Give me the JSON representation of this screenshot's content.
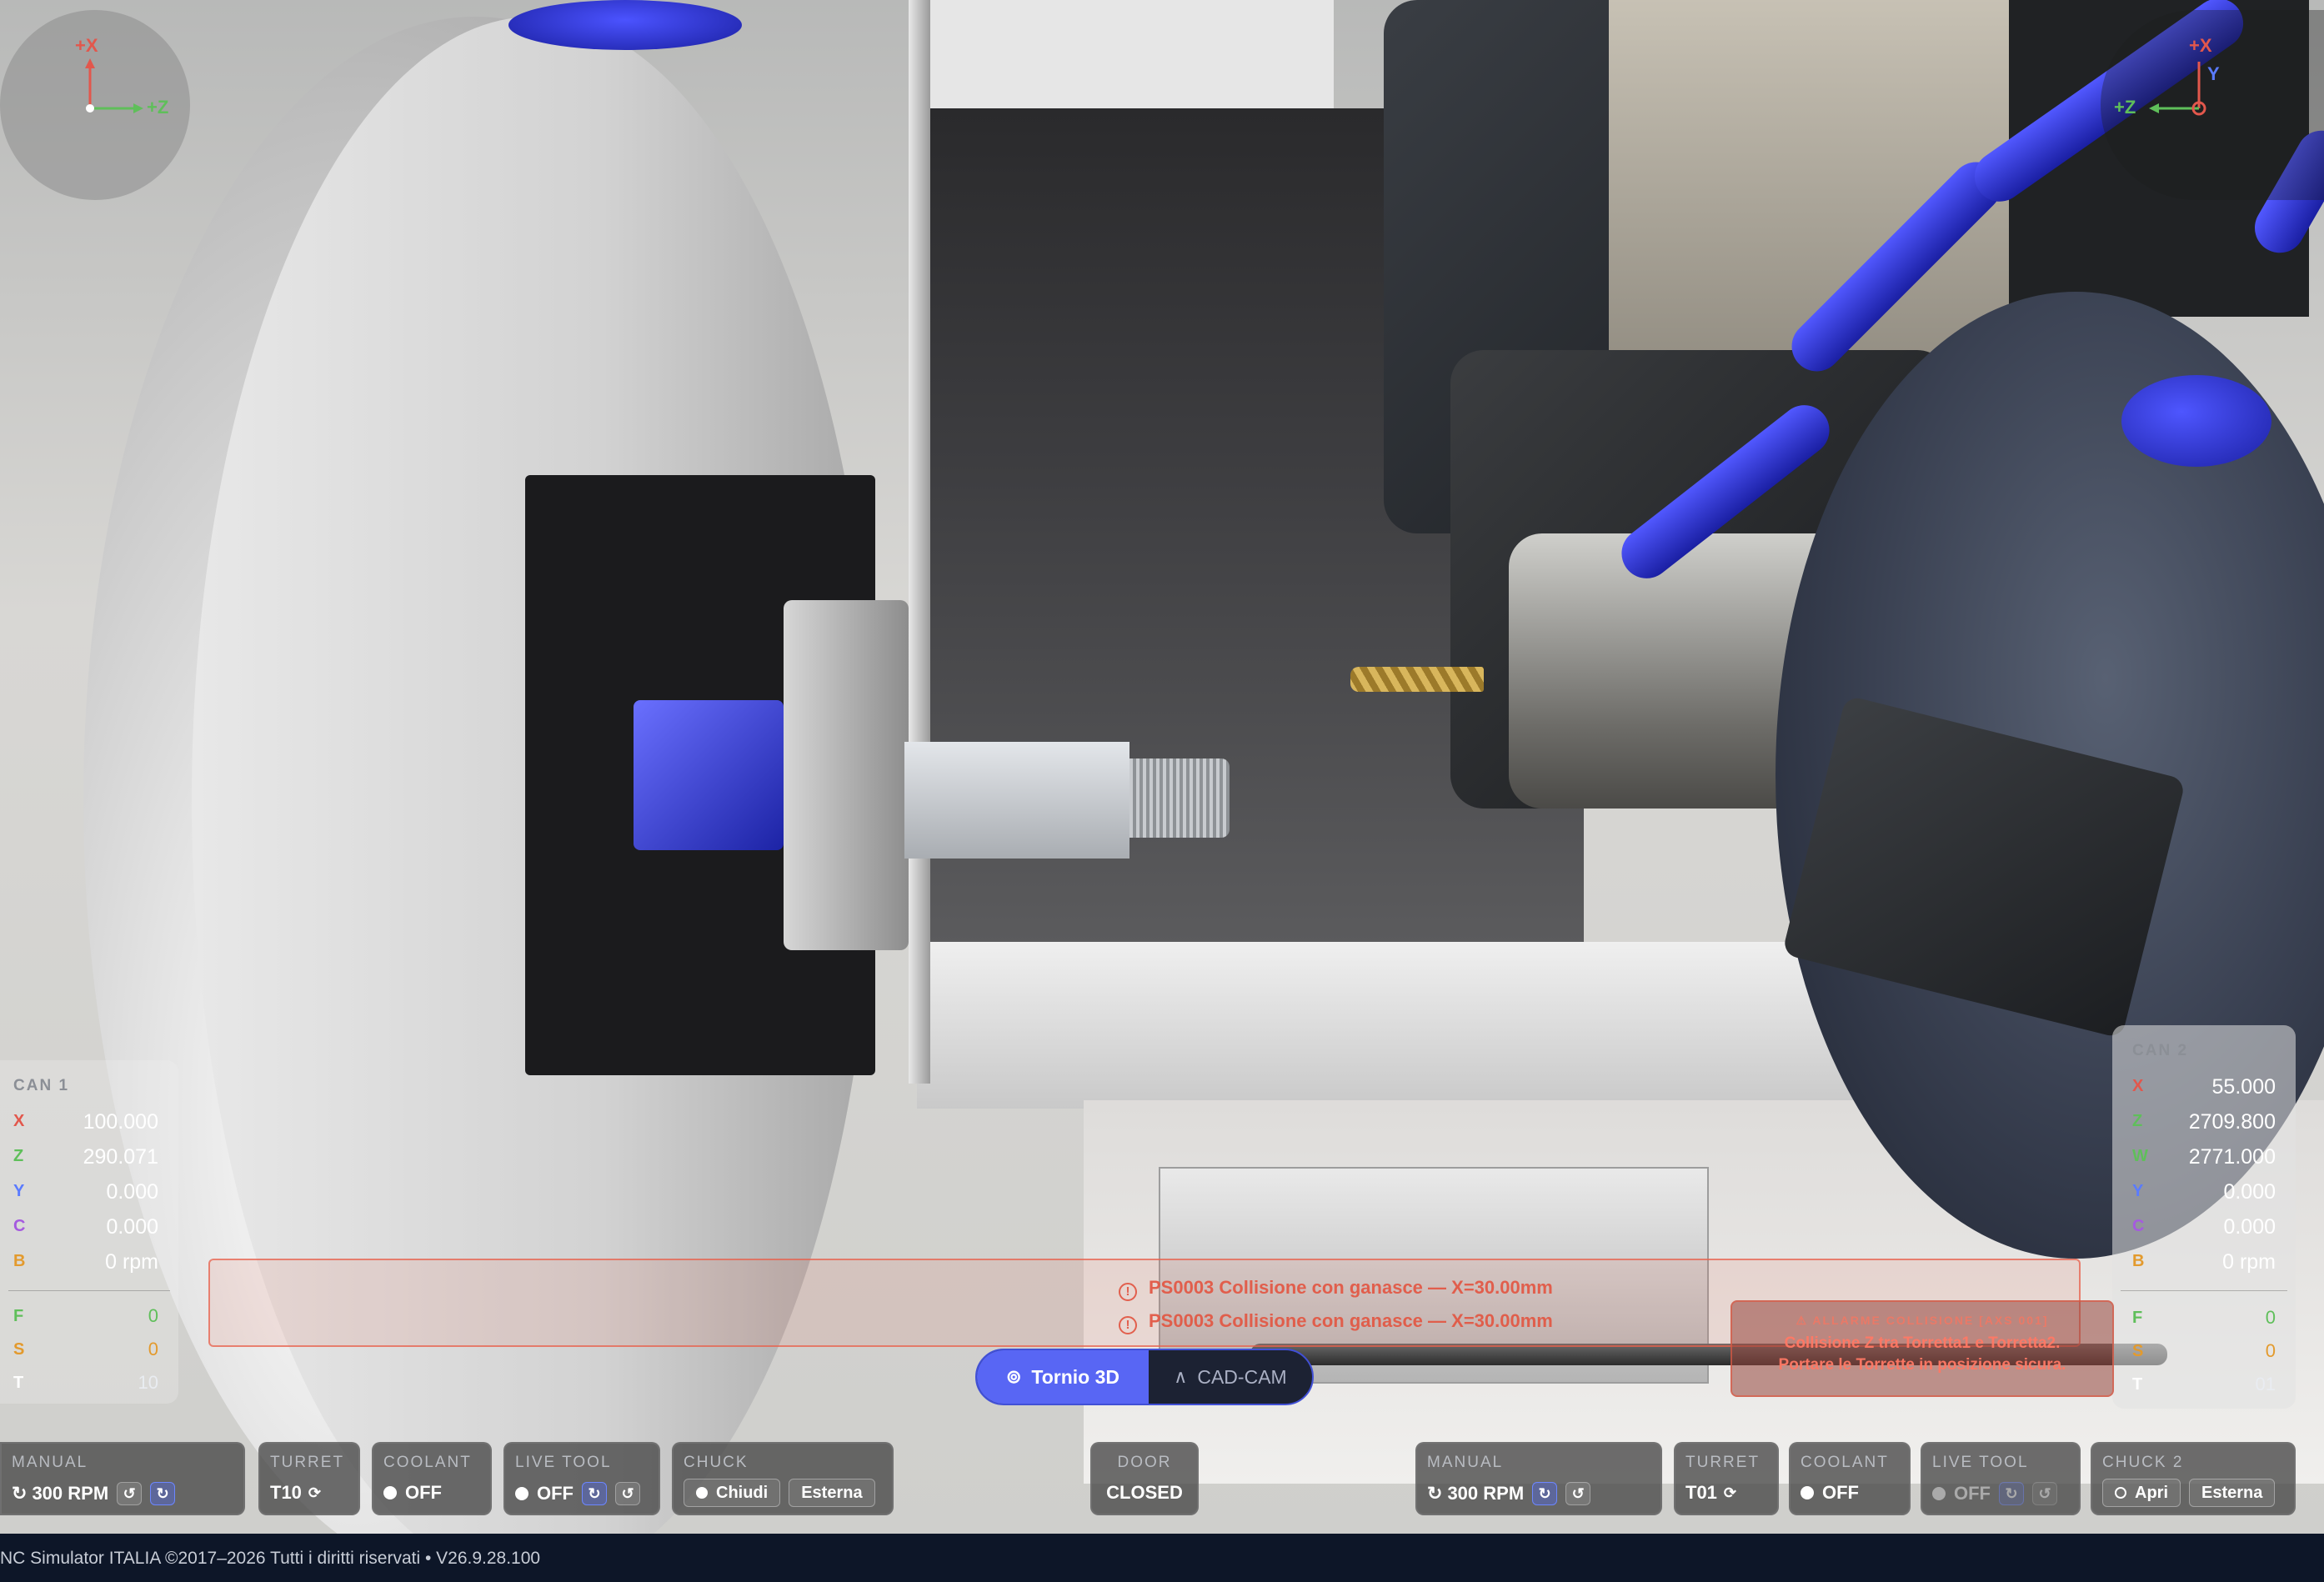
{
  "app": {
    "footer": "NC Simulator ITALIA  ©2017–2026  Tutti i diritti riservati  •  V26.9.28.100"
  },
  "gizmo_left": {
    "x_label": "+X",
    "z_label": "+Z"
  },
  "gizmo_right": {
    "x_label": "+X",
    "y_label": "Y",
    "z_label": "+Z"
  },
  "dro_left": {
    "title": "CAN 1",
    "rows": [
      {
        "axis": "X",
        "value": "100.000",
        "color": "#e2574c"
      },
      {
        "axis": "Z",
        "value": "290.071",
        "color": "#5fbf5a"
      },
      {
        "axis": "Y",
        "value": "0.000",
        "color": "#5a7bff"
      },
      {
        "axis": "C",
        "value": "0.000",
        "color": "#a55adf"
      },
      {
        "axis": "B",
        "value": "0 rpm",
        "color": "#e39a2d"
      }
    ],
    "feed_rows": [
      {
        "axis": "F",
        "value": "0",
        "color": "#5fbf5a"
      },
      {
        "axis": "S",
        "value": "0",
        "color": "#e39a2d"
      },
      {
        "axis": "T",
        "value": "10",
        "color": "#cfd3da"
      }
    ]
  },
  "dro_right": {
    "title": "CAN 2",
    "rows": [
      {
        "axis": "X",
        "value": "55.000",
        "color": "#e2574c"
      },
      {
        "axis": "Z",
        "value": "2709.800",
        "color": "#5fbf5a"
      },
      {
        "axis": "W",
        "value": "2771.000",
        "color": "#5fbf5a"
      },
      {
        "axis": "Y",
        "value": "0.000",
        "color": "#5a7bff"
      },
      {
        "axis": "C",
        "value": "0.000",
        "color": "#a55adf"
      },
      {
        "axis": "B",
        "value": "0 rpm",
        "color": "#e39a2d"
      }
    ],
    "feed_rows": [
      {
        "axis": "F",
        "value": "0",
        "color": "#5fbf5a"
      },
      {
        "axis": "S",
        "value": "0",
        "color": "#e39a2d"
      },
      {
        "axis": "T",
        "value": "01",
        "color": "#cfd3da"
      }
    ]
  },
  "alarms": [
    "PS0003 Collisione con ganasce — X=30.00mm",
    "PS0003 Collisione con ganasce — X=30.00mm"
  ],
  "alarm_box": {
    "title": "⚠ ALLARME COLLISIONE [AXS 001]",
    "line1": "Collisione Z tra Torretta1 e Torretta2.",
    "line2": "Portare le Torrette in posizione sicura."
  },
  "mode_switch": {
    "active": "Tornio 3D",
    "inactive": "CAD-CAM"
  },
  "left_controls": {
    "manual": {
      "title": "MANUAL",
      "value": "300 RPM"
    },
    "turret": {
      "title": "TURRET",
      "value": "T10"
    },
    "coolant": {
      "title": "COOLANT",
      "value": "OFF"
    },
    "live_tool": {
      "title": "LIVE TOOL",
      "value": "OFF"
    },
    "chuck": {
      "title": "CHUCK",
      "state": "Chiudi",
      "mode": "Esterna"
    }
  },
  "door": {
    "title": "DOOR",
    "value": "CLOSED"
  },
  "right_controls": {
    "manual": {
      "title": "MANUAL",
      "value": "300 RPM"
    },
    "turret": {
      "title": "TURRET",
      "value": "T01"
    },
    "coolant": {
      "title": "COOLANT",
      "value": "OFF"
    },
    "live_tool": {
      "title": "LIVE TOOL",
      "value": "OFF"
    },
    "chuck": {
      "title": "CHUCK 2",
      "state": "Apri",
      "mode": "Esterna"
    }
  }
}
